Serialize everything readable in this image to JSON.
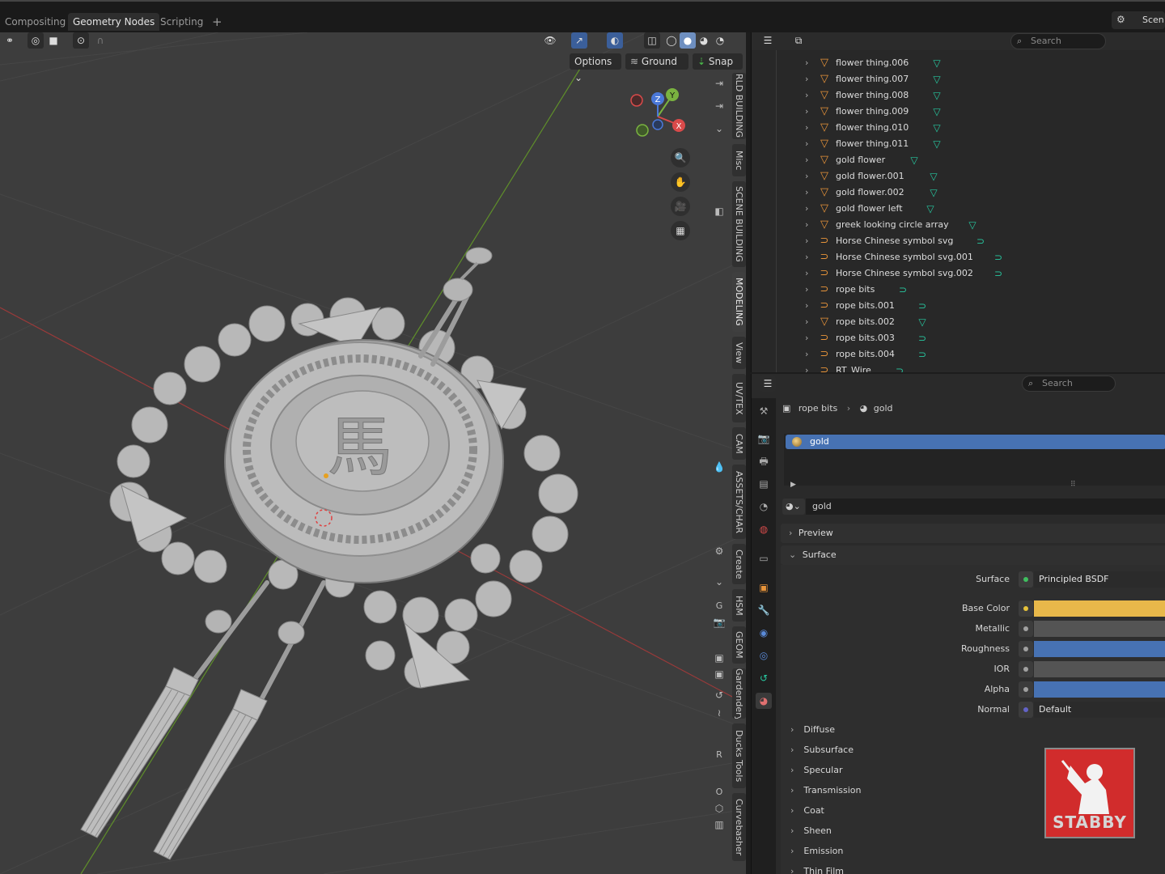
{
  "workspace_tabs": [
    "Compositing",
    "Geometry Nodes",
    "Scripting"
  ],
  "active_workspace": "Geometry Nodes",
  "add_tab": "+",
  "scene_label": "Scen",
  "viewport": {
    "options_label": "Options",
    "ground_label": "Ground",
    "snap_label": "Snap",
    "gizmo": {
      "x": "X",
      "y": "Y",
      "z": "Z"
    },
    "sidebar_tabs": [
      "RLD BUILDING",
      "Misc",
      "SCENE BUILDING",
      "MODELING",
      "View",
      "UV/TEX",
      "CAM",
      "ASSETS/CHAR",
      "Create",
      "HSM",
      "GEOM",
      "Gardendery",
      "Ducks Tools",
      "Curvebasher"
    ],
    "active_sidebar_tab": "MODELING",
    "letters": {
      "g": "G",
      "r": "R",
      "o": "O"
    }
  },
  "outliner": {
    "search_placeholder": "Search",
    "rows": [
      {
        "name": "flower thing.006",
        "type": "mesh",
        "mod": "mesh"
      },
      {
        "name": "flower thing.007",
        "type": "mesh",
        "mod": "mesh"
      },
      {
        "name": "flower thing.008",
        "type": "mesh",
        "mod": "mesh"
      },
      {
        "name": "flower thing.009",
        "type": "mesh",
        "mod": "mesh"
      },
      {
        "name": "flower thing.010",
        "type": "mesh",
        "mod": "mesh"
      },
      {
        "name": "flower thing.011",
        "type": "mesh",
        "mod": "mesh"
      },
      {
        "name": "gold flower",
        "type": "mesh",
        "mod": "mesh"
      },
      {
        "name": "gold flower.001",
        "type": "mesh",
        "mod": "mesh"
      },
      {
        "name": "gold flower.002",
        "type": "mesh",
        "mod": "mesh"
      },
      {
        "name": "gold flower left",
        "type": "mesh",
        "mod": "mesh"
      },
      {
        "name": "greek looking circle array",
        "type": "mesh",
        "mod": "mesh"
      },
      {
        "name": "Horse Chinese symbol svg",
        "type": "curve",
        "mod": "curve"
      },
      {
        "name": "Horse Chinese symbol svg.001",
        "type": "curve",
        "mod": "curve"
      },
      {
        "name": "Horse Chinese symbol svg.002",
        "type": "curve",
        "mod": "curve"
      },
      {
        "name": "rope bits",
        "type": "curve",
        "mod": "curve"
      },
      {
        "name": "rope bits.001",
        "type": "curve",
        "mod": "curve"
      },
      {
        "name": "rope bits.002",
        "type": "mesh",
        "mod": "mesh"
      },
      {
        "name": "rope bits.003",
        "type": "curve",
        "mod": "curve"
      },
      {
        "name": "rope bits.004",
        "type": "curve",
        "mod": "curve"
      },
      {
        "name": "RT_Wire",
        "type": "curve",
        "mod": "curve"
      }
    ]
  },
  "properties": {
    "search_placeholder": "Search",
    "breadcrumb_object": "rope bits",
    "breadcrumb_material": "gold",
    "material_slot": "gold",
    "material_name": "gold",
    "panels": {
      "preview": "Preview",
      "surface": "Surface"
    },
    "surface_rows": [
      {
        "label": "Surface",
        "value": "Principled BSDF",
        "dot": "#3fbf5f",
        "fill": "#2b2b2b"
      },
      {
        "label": "Base Color",
        "value": "",
        "dot": "#e6c23a",
        "fill": "#e8b84a"
      },
      {
        "label": "Metallic",
        "value": "",
        "dot": "#a0a0a0",
        "fill": "#545454"
      },
      {
        "label": "Roughness",
        "value": "",
        "dot": "#a0a0a0",
        "fill": "#4772b3"
      },
      {
        "label": "IOR",
        "value": "",
        "dot": "#a0a0a0",
        "fill": "#545454"
      },
      {
        "label": "Alpha",
        "value": "",
        "dot": "#a0a0a0",
        "fill": "#4772b3"
      },
      {
        "label": "Normal",
        "value": "Default",
        "dot": "#6363c7",
        "fill": "#2b2b2b"
      }
    ],
    "subpanels": [
      "Diffuse",
      "Subsurface",
      "Specular",
      "Transmission",
      "Coat",
      "Sheen",
      "Emission",
      "Thin Film"
    ]
  },
  "watermark": "STABBY",
  "colors": {
    "accent": "#4772b3",
    "gold": "#e8b84a",
    "mesh_icon": "#e8943a",
    "modifier_icon": "#27c8a0"
  }
}
